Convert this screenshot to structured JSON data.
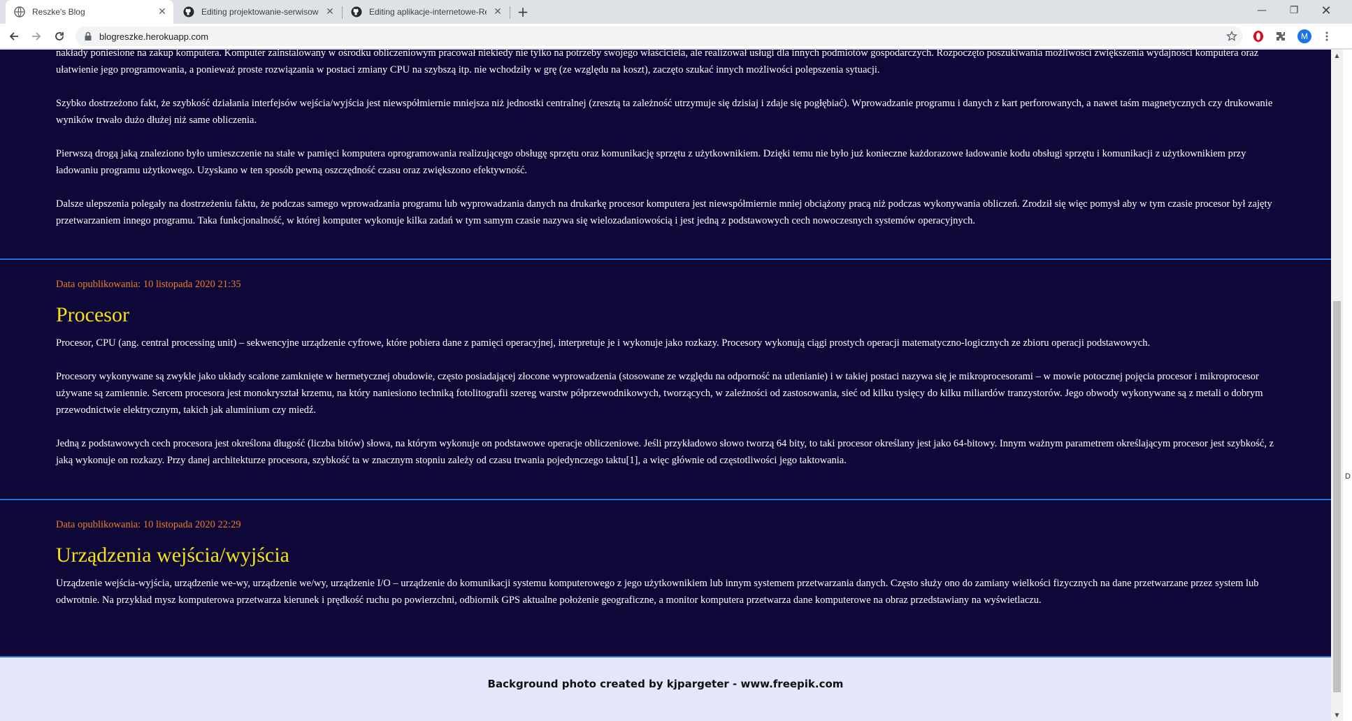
{
  "browser": {
    "tabs": [
      {
        "title": "Reszke's Blog",
        "active": true
      },
      {
        "title": "Editing projektowanie-serwisow-",
        "active": false
      },
      {
        "title": "Editing aplikacje-internetowe-Re",
        "active": false
      }
    ],
    "url": "blogreszke.herokuapp.com",
    "profile_initial": "M"
  },
  "page": {
    "intro_paragraphs": [
      "nakłady poniesione na zakup komputera. Komputer zainstalowany w ośrodku obliczeniowym pracował niekiedy nie tylko na potrzeby swojego właściciela, ale realizował usługi dla innych podmiotów gospodarczych. Rozpoczęto poszukiwania możliwości zwiększenia wydajności komputera oraz ułatwienie jego programowania, a ponieważ proste rozwiązania w postaci zmiany CPU na szybszą itp. nie wchodziły w grę (ze względu na koszt), zaczęto szukać innych możliwości polepszenia sytuacji.",
      "Szybko dostrzeżono fakt, że szybkość działania interfejsów wejścia/wyjścia jest niewspółmiernie mniejsza niż jednostki centralnej (zresztą ta zależność utrzymuje się dzisiaj i zdaje się pogłębiać). Wprowadzanie programu i danych z kart perforowanych, a nawet taśm magnetycznych czy drukowanie wyników trwało dużo dłużej niż same obliczenia.",
      "Pierwszą drogą jaką znaleziono było umieszczenie na stałe w pamięci komputera oprogramowania realizującego obsługę sprzętu oraz komunikację sprzętu z użytkownikiem. Dzięki temu nie było już konieczne każdorazowe ładowanie kodu obsługi sprzętu i komunikacji z użytkownikiem przy ładowaniu programu użytkowego. Uzyskano w ten sposób pewną oszczędność czasu oraz zwiększono efektywność.",
      "Dalsze ulepszenia polegały na dostrzeżeniu faktu, że podczas samego wprowadzania programu lub wyprowadzania danych na drukarkę procesor komputera jest niewspółmiernie mniej obciążony pracą niż podczas wykonywania obliczeń. Zrodził się więc pomysł aby w tym czasie procesor był zajęty przetwarzaniem innego programu. Taka funkcjonalność, w której komputer wykonuje kilka zadań w tym samym czasie nazywa się wielozadaniowością i jest jedną z podstawowych cech nowoczesnych systemów operacyjnych."
    ],
    "posts": [
      {
        "date": "Data opublikowania: 10 listopada 2020 21:35",
        "title": "Procesor",
        "paragraphs": [
          "Procesor, CPU (ang. central processing unit) – sekwencyjne urządzenie cyfrowe, które pobiera dane z pamięci operacyjnej, interpretuje je i wykonuje jako rozkazy. Procesory wykonują ciągi prostych operacji matematyczno-logicznych ze zbioru operacji podstawowych.",
          "Procesory wykonywane są zwykle jako układy scalone zamknięte w hermetycznej obudowie, często posiadającej złocone wyprowadzenia (stosowane ze względu na odporność na utlenianie) i w takiej postaci nazywa się je mikroprocesorami – w mowie potocznej pojęcia procesor i mikroprocesor używane są zamiennie. Sercem procesora jest monokryształ krzemu, na który naniesiono techniką fotolitografii szereg warstw półprzewodnikowych, tworzących, w zależności od zastosowania, sieć od kilku tysięcy do kilku miliardów tranzystorów. Jego obwody wykonywane są z metali o dobrym przewodnictwie elektrycznym, takich jak aluminium czy miedź.",
          "Jedną z podstawowych cech procesora jest określona długość (liczba bitów) słowa, na którym wykonuje on podstawowe operacje obliczeniowe. Jeśli przykładowo słowo tworzą 64 bity, to taki procesor określany jest jako 64-bitowy. Innym ważnym parametrem określającym procesor jest szybkość, z jaką wykonuje on rozkazy. Przy danej architekturze procesora, szybkość ta w znacznym stopniu zależy od czasu trwania pojedynczego taktu[1], a więc głównie od częstotliwości jego taktowania."
        ]
      },
      {
        "date": "Data opublikowania: 10 listopada 2020 22:29",
        "title": "Urządzenia wejścia/wyjścia",
        "paragraphs": [
          "Urządzenie wejścia-wyjścia, urządzenie we-wy, urządzenie we/wy, urządzenie I/O – urządzenie do komunikacji systemu komputerowego z jego użytkownikiem lub innym systemem przetwarzania danych. Często służy ono do zamiany wielkości fizycznych na dane przetwarzane przez system lub odwrotnie. Na przykład mysz komputerowa przetwarza kierunek i prędkość ruchu po powierzchni, odbiornik GPS aktualne położenie geograficzne, a monitor komputera przetwarza dane komputerowe na obraz przedstawiany na wyświetlaczu."
        ]
      }
    ],
    "footer": "Background photo created by kjpargeter - www.freepik.com",
    "edge_letter": "D"
  }
}
